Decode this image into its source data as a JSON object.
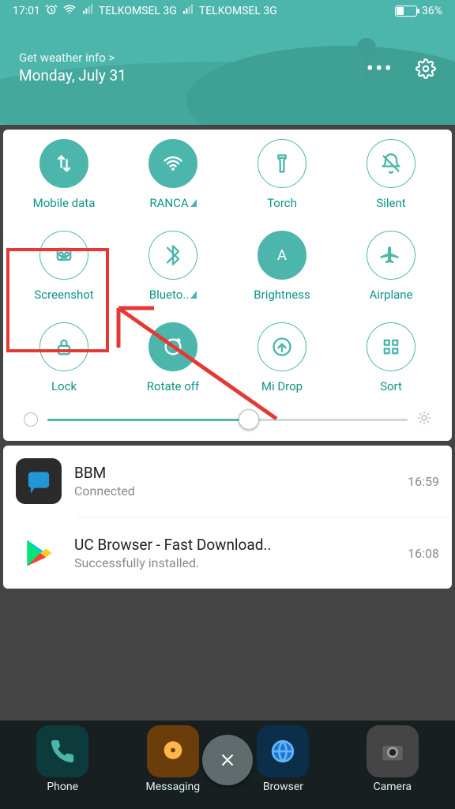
{
  "status_bar": {
    "time": "17:01",
    "carrier1": "TELKOMSEL 3G",
    "carrier2": "TELKOMSEL 3G",
    "battery_pct": "36%"
  },
  "header": {
    "weather_prompt": "Get weather info >",
    "date": "Monday, July 31"
  },
  "quick_settings": {
    "items": [
      {
        "label": "Mobile data",
        "icon": "swap-vert",
        "filled": true,
        "signal": false
      },
      {
        "label": "RANCA",
        "icon": "wifi",
        "filled": true,
        "signal": true
      },
      {
        "label": "Torch",
        "icon": "flashlight",
        "filled": false,
        "signal": false
      },
      {
        "label": "Silent",
        "icon": "bell-off",
        "filled": false,
        "signal": false
      },
      {
        "label": "Screenshot",
        "icon": "screenshot",
        "filled": false,
        "signal": false
      },
      {
        "label": "Blueto..",
        "icon": "bluetooth",
        "filled": false,
        "signal": true
      },
      {
        "label": "Brightness",
        "icon": "brightness",
        "filled": true,
        "signal": false
      },
      {
        "label": "Airplane",
        "icon": "airplane",
        "filled": false,
        "signal": false
      },
      {
        "label": "Lock",
        "icon": "lock",
        "filled": false,
        "signal": false
      },
      {
        "label": "Rotate off",
        "icon": "rotate",
        "filled": true,
        "signal": false
      },
      {
        "label": "Mi Drop",
        "icon": "midrop",
        "filled": false,
        "signal": false
      },
      {
        "label": "Sort",
        "icon": "grid",
        "filled": false,
        "signal": false
      }
    ],
    "brightness_value": 56
  },
  "notifications": [
    {
      "title": "BBM",
      "subtitle": "Connected",
      "time": "16:59",
      "icon": "bbm"
    },
    {
      "title": "UC Browser - Fast Download..",
      "subtitle": "Successfully installed.",
      "time": "16:08",
      "icon": "play"
    }
  ],
  "dock": {
    "items": [
      {
        "label": "Phone"
      },
      {
        "label": "Messaging"
      },
      {
        "label": "Browser"
      },
      {
        "label": "Camera"
      }
    ]
  },
  "annotation": {
    "target_index": 4
  }
}
